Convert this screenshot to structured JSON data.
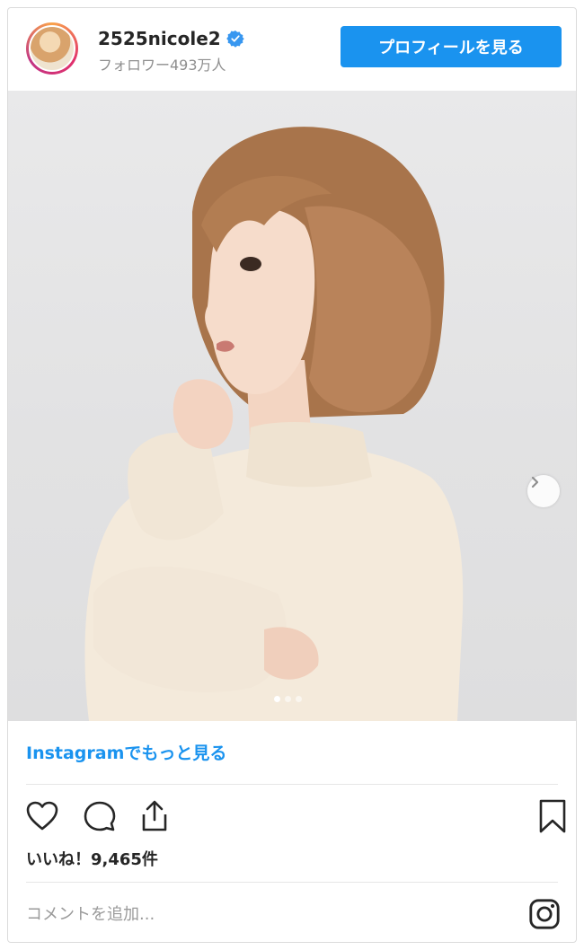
{
  "header": {
    "username": "2525nicole2",
    "verified_icon": "verified-badge-icon",
    "followers": "フォロワー493万人",
    "profile_button": "プロフィールを見る"
  },
  "post": {
    "carousel_total": 3,
    "carousel_index": 1,
    "more_link": "Instagramでもっと見る",
    "likes": "いいね！9,465件",
    "comment_placeholder": "コメントを追加..."
  },
  "icons": [
    "heart-icon",
    "comment-icon",
    "share-icon",
    "bookmark-icon",
    "instagram-icon",
    "chevron-right-icon"
  ],
  "colors": {
    "accent": "#1a93ef",
    "text": "#262626",
    "muted": "#8e8e8e"
  }
}
